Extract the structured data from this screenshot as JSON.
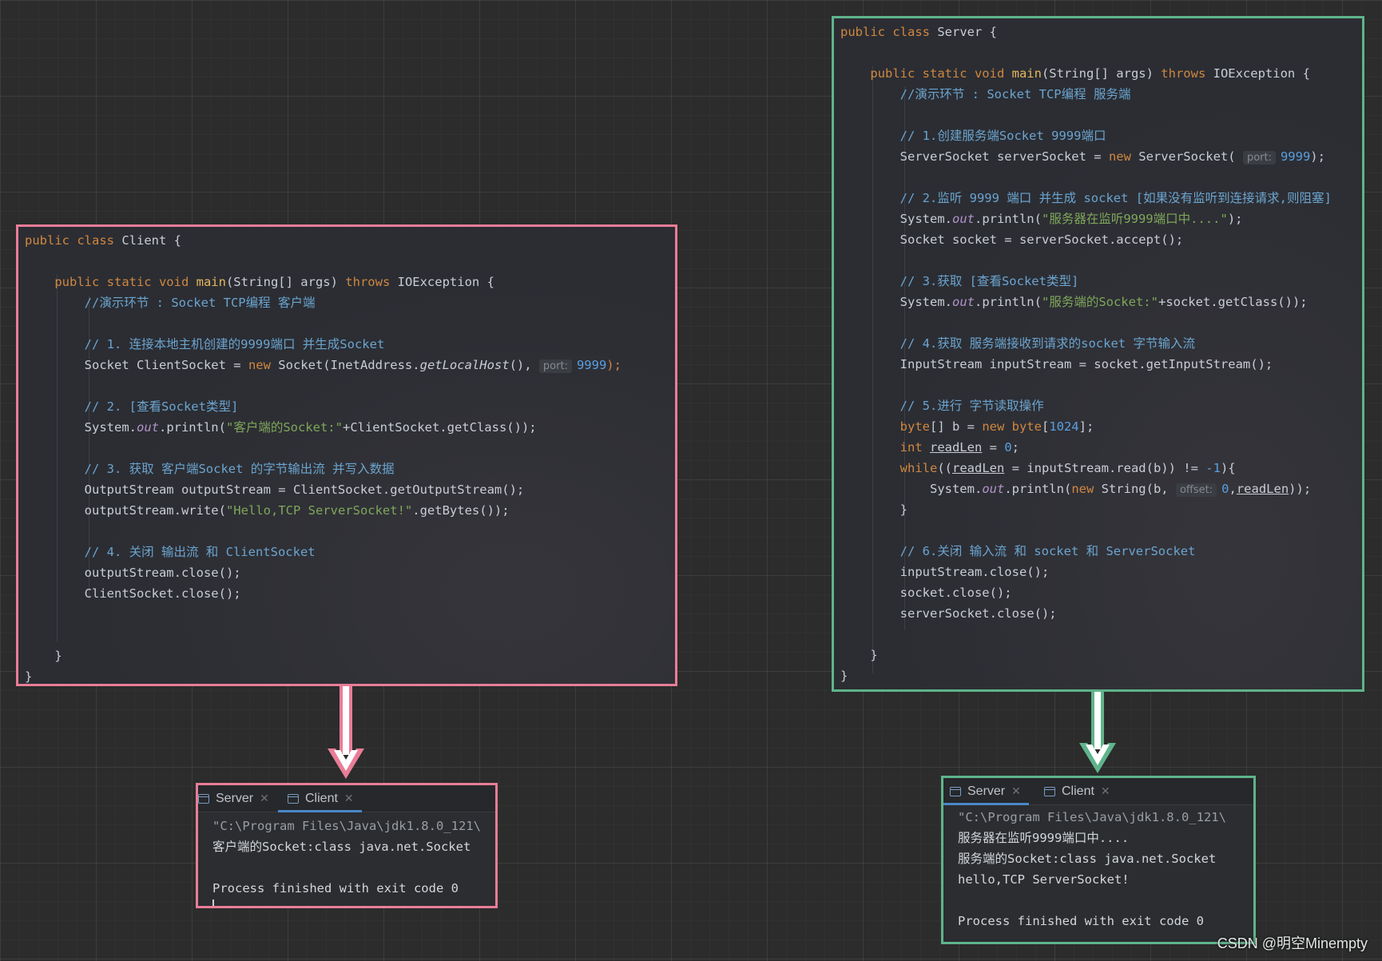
{
  "client_code": {
    "lines": [
      [
        {
          "t": "public class ",
          "c": "kw"
        },
        {
          "t": "Client {"
        }
      ],
      [],
      [
        {
          "t": "    "
        },
        {
          "t": "public static void ",
          "c": "kw"
        },
        {
          "t": "main",
          "c": "fn"
        },
        {
          "t": "(String[] args) "
        },
        {
          "t": "throws ",
          "c": "kw"
        },
        {
          "t": "IOException {"
        }
      ],
      [
        {
          "t": "        "
        },
        {
          "t": "//演示环节 : Socket TCP编程 客户端",
          "c": "cm"
        }
      ],
      [],
      [
        {
          "t": "        "
        },
        {
          "t": "// 1. 连接本地主机创建的9999端口 并生成Socket",
          "c": "cm"
        }
      ],
      [
        {
          "t": "        Socket ClientSocket = "
        },
        {
          "t": "new ",
          "c": "kw"
        },
        {
          "t": "Socket(InetAddress."
        },
        {
          "t": "getLocalHost",
          "c": "itn"
        },
        {
          "t": "(), "
        },
        {
          "t": "port:",
          "c": "hint"
        },
        {
          "t": "9999",
          "c": "nm"
        },
        {
          "t": ");",
          "c": "kw"
        }
      ],
      [],
      [
        {
          "t": "        "
        },
        {
          "t": "// 2. [查看Socket类型]",
          "c": "cm"
        }
      ],
      [
        {
          "t": "        System."
        },
        {
          "t": "out",
          "c": "it"
        },
        {
          "t": ".println("
        },
        {
          "t": "\"客户端的Socket:\"",
          "c": "st"
        },
        {
          "t": "+ClientSocket.getClass());"
        }
      ],
      [],
      [
        {
          "t": "        "
        },
        {
          "t": "// 3. 获取 客户端Socket 的字节输出流 并写入数据",
          "c": "cm"
        }
      ],
      [
        {
          "t": "        OutputStream outputStream = ClientSocket.getOutputStream();"
        }
      ],
      [
        {
          "t": "        outputStream.write("
        },
        {
          "t": "\"Hello,TCP ServerSocket!\"",
          "c": "st"
        },
        {
          "t": ".getBytes());"
        }
      ],
      [],
      [
        {
          "t": "        "
        },
        {
          "t": "// 4. 关闭 输出流 和 ClientSocket",
          "c": "cm"
        }
      ],
      [
        {
          "t": "        outputStream.close();"
        }
      ],
      [
        {
          "t": "        ClientSocket.close();"
        }
      ],
      [],
      [],
      [
        {
          "t": "    }"
        }
      ],
      [
        {
          "t": "}"
        }
      ]
    ]
  },
  "server_code": {
    "lines": [
      [
        {
          "t": "public class ",
          "c": "kw"
        },
        {
          "t": "Server {"
        }
      ],
      [],
      [
        {
          "t": "    "
        },
        {
          "t": "public static void ",
          "c": "kw"
        },
        {
          "t": "main",
          "c": "fn"
        },
        {
          "t": "(String[] args) "
        },
        {
          "t": "throws ",
          "c": "kw"
        },
        {
          "t": "IOException {"
        }
      ],
      [
        {
          "t": "        "
        },
        {
          "t": "//演示环节 : Socket TCP编程 服务端",
          "c": "cm"
        }
      ],
      [],
      [
        {
          "t": "        "
        },
        {
          "t": "// 1.创建服务端Socket 9999端口",
          "c": "cm"
        }
      ],
      [
        {
          "t": "        ServerSocket serverSocket = "
        },
        {
          "t": "new ",
          "c": "kw"
        },
        {
          "t": "ServerSocket( "
        },
        {
          "t": "port:",
          "c": "hint"
        },
        {
          "t": "9999",
          "c": "nm"
        },
        {
          "t": ");"
        }
      ],
      [],
      [
        {
          "t": "        "
        },
        {
          "t": "// 2.监听 9999 端口 并生成 socket [如果没有监听到连接请求,则阻塞]",
          "c": "cm"
        }
      ],
      [
        {
          "t": "        System."
        },
        {
          "t": "out",
          "c": "it"
        },
        {
          "t": ".println("
        },
        {
          "t": "\"服务器在监听9999端口中....\"",
          "c": "st"
        },
        {
          "t": ");"
        }
      ],
      [
        {
          "t": "        Socket socket = serverSocket.accept();"
        }
      ],
      [],
      [
        {
          "t": "        "
        },
        {
          "t": "// 3.获取 [查看Socket类型]",
          "c": "cm"
        }
      ],
      [
        {
          "t": "        System."
        },
        {
          "t": "out",
          "c": "it"
        },
        {
          "t": ".println("
        },
        {
          "t": "\"服务端的Socket:\"",
          "c": "st"
        },
        {
          "t": "+socket.getClass());"
        }
      ],
      [],
      [
        {
          "t": "        "
        },
        {
          "t": "// 4.获取 服务端接收到请求的socket 字节输入流",
          "c": "cm"
        }
      ],
      [
        {
          "t": "        InputStream inputStream = socket.getInputStream();"
        }
      ],
      [],
      [
        {
          "t": "        "
        },
        {
          "t": "// 5.进行 字节读取操作",
          "c": "cm"
        }
      ],
      [
        {
          "t": "        "
        },
        {
          "t": "byte",
          "c": "kw"
        },
        {
          "t": "[] b = "
        },
        {
          "t": "new byte",
          "c": "kw"
        },
        {
          "t": "["
        },
        {
          "t": "1024",
          "c": "nm"
        },
        {
          "t": "];"
        }
      ],
      [
        {
          "t": "        "
        },
        {
          "t": "int ",
          "c": "kw"
        },
        {
          "t": "readLen",
          "c": "ul"
        },
        {
          "t": " = "
        },
        {
          "t": "0",
          "c": "nm"
        },
        {
          "t": ";"
        }
      ],
      [
        {
          "t": "        "
        },
        {
          "t": "while",
          "c": "kw"
        },
        {
          "t": "(("
        },
        {
          "t": "readLen",
          "c": "ul"
        },
        {
          "t": " = inputStream.read(b)) != "
        },
        {
          "t": "-1",
          "c": "nm"
        },
        {
          "t": "){"
        }
      ],
      [
        {
          "t": "            System."
        },
        {
          "t": "out",
          "c": "it"
        },
        {
          "t": ".println("
        },
        {
          "t": "new ",
          "c": "kw"
        },
        {
          "t": "String(b, "
        },
        {
          "t": "offset:",
          "c": "hint"
        },
        {
          "t": "0",
          "c": "nm"
        },
        {
          "t": ","
        },
        {
          "t": "readLen",
          "c": "ul"
        },
        {
          "t": "));"
        }
      ],
      [
        {
          "t": "        }"
        }
      ],
      [],
      [
        {
          "t": "        "
        },
        {
          "t": "// 6.关闭 输入流 和 socket 和 ServerSocket",
          "c": "cm"
        }
      ],
      [
        {
          "t": "        inputStream.close();"
        }
      ],
      [
        {
          "t": "        socket.close();"
        }
      ],
      [
        {
          "t": "        serverSocket.close();"
        }
      ],
      [],
      [
        {
          "t": "    }"
        }
      ],
      [
        {
          "t": "}"
        }
      ]
    ]
  },
  "client_console": {
    "tabs": [
      {
        "label": "Server",
        "active": false
      },
      {
        "label": "Client",
        "active": true
      }
    ],
    "output": [
      "\"C:\\Program Files\\Java\\jdk1.8.0_121\\",
      "客户端的Socket:class java.net.Socket",
      "",
      "Process finished with exit code 0"
    ]
  },
  "server_console": {
    "tabs": [
      {
        "label": "Server",
        "active": true
      },
      {
        "label": "Client",
        "active": false
      }
    ],
    "output": [
      "\"C:\\Program Files\\Java\\jdk1.8.0_121\\",
      "服务器在监听9999端口中....",
      "服务端的Socket:class java.net.Socket",
      "hello,TCP ServerSocket!",
      "",
      "Process finished with exit code 0"
    ]
  },
  "watermark": "CSDN @明空Minempty",
  "colors": {
    "client_frame": "#e97d98",
    "server_frame": "#5fb48b",
    "keyword": "#d0873f",
    "comment": "#6ba4cf",
    "string": "#7fa75a",
    "number": "#5a9fe0"
  }
}
